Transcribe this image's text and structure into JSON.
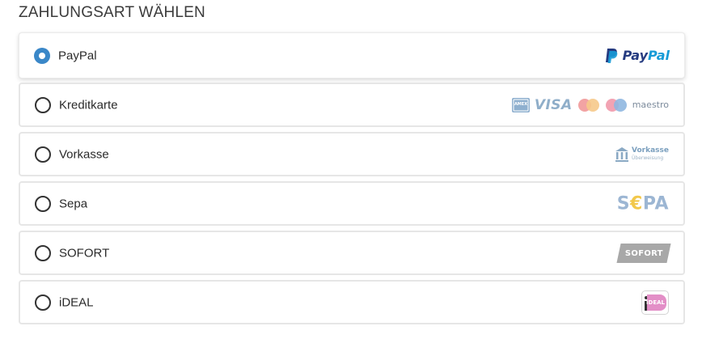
{
  "heading": "ZAHLUNGSART WÄHLEN",
  "methods": [
    {
      "label": "PayPal",
      "selected": true,
      "logo": "paypal-logo",
      "logo_text_a": "Pay",
      "logo_text_b": "Pal"
    },
    {
      "label": "Kreditkarte",
      "selected": false,
      "logo": "credit-card-logos",
      "amex_text": "AMEX",
      "visa_text": "VISA",
      "maestro_text": "maestro"
    },
    {
      "label": "Vorkasse",
      "selected": false,
      "logo": "vorkasse-logo",
      "logo_text": "Vorkasse",
      "logo_subtext": "Überweisung"
    },
    {
      "label": "Sepa",
      "selected": false,
      "logo": "sepa-logo",
      "logo_text_a": "S",
      "logo_text_b": "€",
      "logo_text_c": "PA"
    },
    {
      "label": "SOFORT",
      "selected": false,
      "logo": "sofort-logo",
      "logo_text": "SOFORT"
    },
    {
      "label": "iDEAL",
      "selected": false,
      "logo": "ideal-logo",
      "logo_text": "iDEAL"
    }
  ],
  "colors": {
    "radio_selected": "#3a87c8",
    "paypal_dark": "#253b80",
    "paypal_light": "#179bd7",
    "border": "#e6e6e6"
  }
}
